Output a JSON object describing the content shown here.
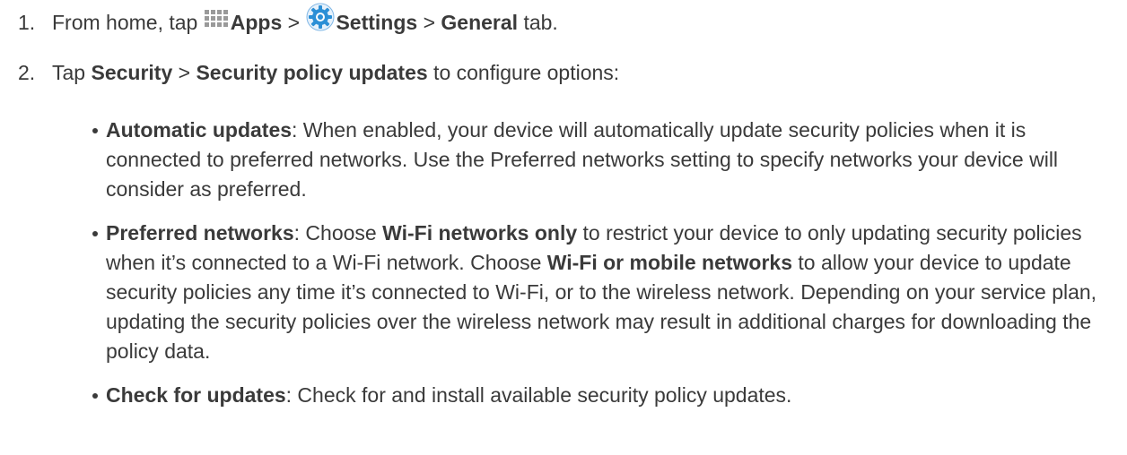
{
  "steps": [
    {
      "number": "1.",
      "t1": "From home, tap",
      "apps_icon": "apps-grid-icon",
      "apps": "Apps",
      "sep1": " > ",
      "settings_icon": "settings-gear-icon",
      "settings": "Settings",
      "sep2": " > ",
      "general": "General",
      "t2": " tab."
    },
    {
      "number": "2.",
      "t1": "Tap ",
      "security": "Security",
      "sep": " > ",
      "policy": "Security policy updates",
      "t2": " to configure options:"
    }
  ],
  "options": [
    {
      "term": "Automatic updates",
      "text": ": When enabled, your device will automatically update security policies when it is connected to preferred networks. Use the Preferred networks setting to specify networks your device will consider as preferred."
    },
    {
      "term": "Preferred networks",
      "text1": ": Choose ",
      "opt1": "Wi-Fi networks only",
      "text2": " to restrict your device to only updating security policies when it’s connected to a Wi-Fi network. Choose ",
      "opt2": "Wi-Fi or mobile networks",
      "text3": " to allow your device to update security policies any time it’s connected to Wi-Fi, or to the wireless network. Depending on your service plan, updating the security policies over the wireless network may result in additional charges for downloading the policy data."
    },
    {
      "term": "Check for updates",
      "text": ": Check for and install available security policy updates."
    }
  ],
  "colors": {
    "text": "#3a3a3a",
    "apps_icon": "#9a9a9a",
    "settings_icon": "#2b8fd6"
  }
}
